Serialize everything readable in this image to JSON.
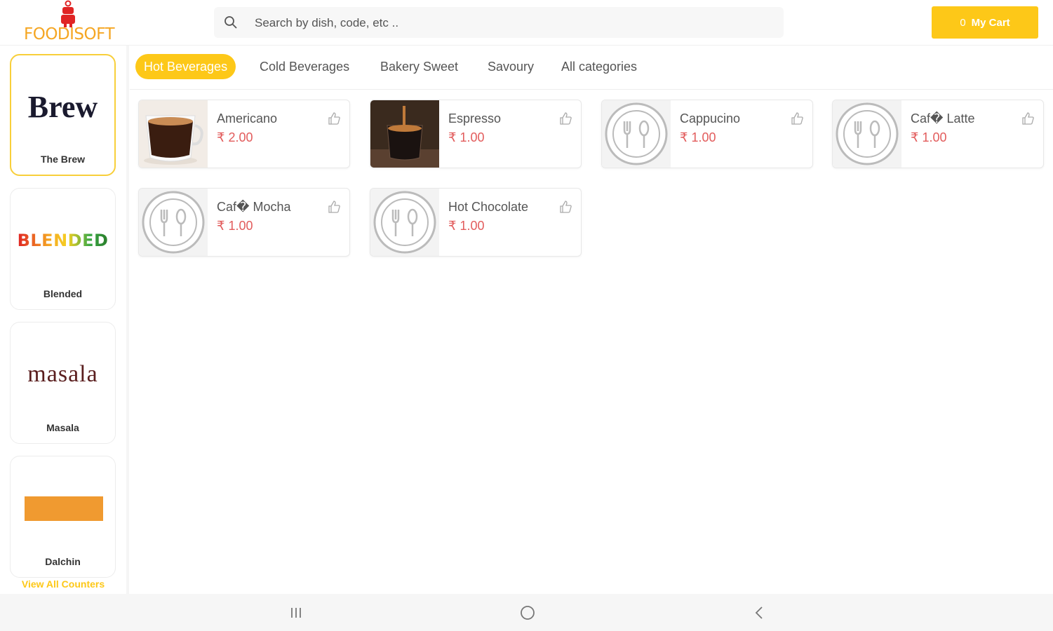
{
  "brand": {
    "logo_text": "FOODISOFT"
  },
  "search": {
    "placeholder": "Search by dish, code, etc .."
  },
  "cart": {
    "count": "0",
    "label": "My Cart"
  },
  "counters": [
    {
      "logo_text": "Brew",
      "name": "The Brew",
      "active": true
    },
    {
      "logo_text": "BLENDED",
      "name": "Blended",
      "active": false
    },
    {
      "logo_text": "masala",
      "name": "Masala",
      "active": false
    },
    {
      "logo_text": "",
      "name": "Dalchin",
      "active": false
    }
  ],
  "view_all_label": "View All Counters",
  "tabs": [
    {
      "label": "Hot Beverages",
      "active": true
    },
    {
      "label": "Cold Beverages",
      "active": false
    },
    {
      "label": "Bakery Sweet",
      "active": false
    },
    {
      "label": "Savoury",
      "active": false
    },
    {
      "label": "All categories",
      "active": false
    }
  ],
  "items": [
    {
      "name": "Americano",
      "price": "₹ 2.00",
      "image": "americano-photo"
    },
    {
      "name": "Espresso",
      "price": "₹ 1.00",
      "image": "espresso-photo"
    },
    {
      "name": "Cappucino",
      "price": "₹ 1.00",
      "image": "placeholder-cutlery-icon"
    },
    {
      "name": "Caf� Latte",
      "price": "₹ 1.00",
      "image": "placeholder-cutlery-icon"
    },
    {
      "name": "Caf� Mocha",
      "price": "₹ 1.00",
      "image": "placeholder-cutlery-icon"
    },
    {
      "name": "Hot Chocolate",
      "price": "₹ 1.00",
      "image": "placeholder-cutlery-icon"
    }
  ],
  "colors": {
    "accent": "#fdc818",
    "price": "#e25c5c",
    "brand_orange": "#f5a623",
    "robot_red": "#e02424"
  }
}
